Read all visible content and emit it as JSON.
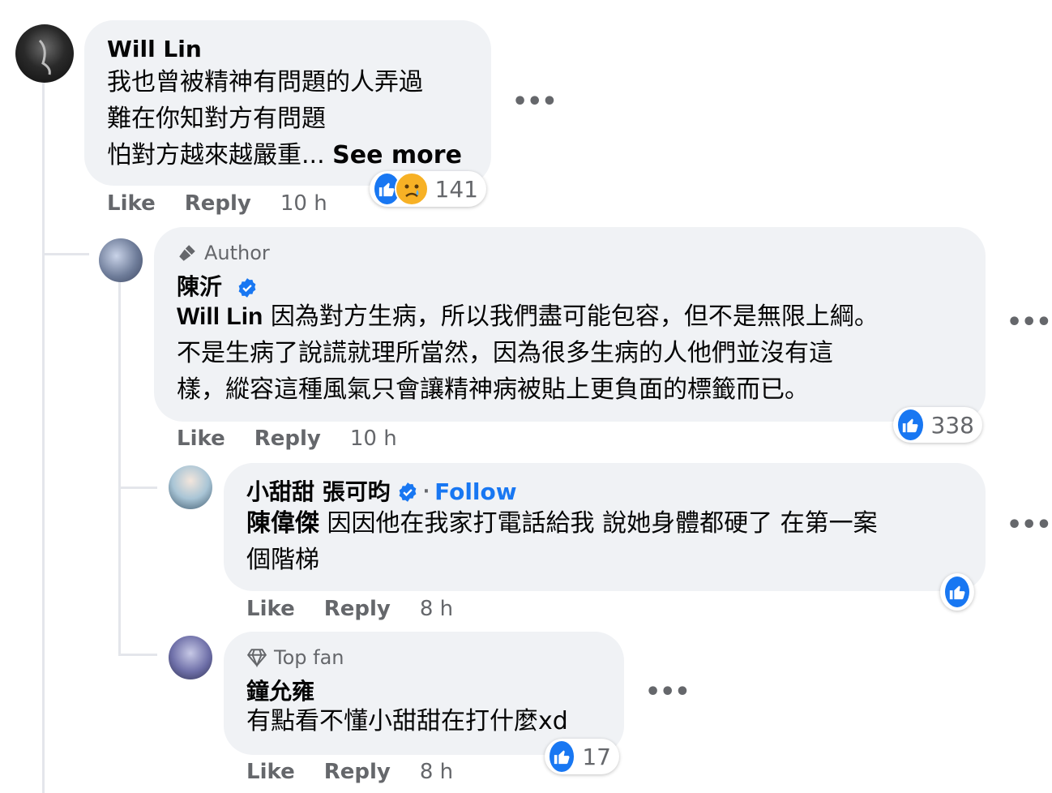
{
  "comments": [
    {
      "author": "Will Lin",
      "lines": [
        "我也曾被精神有問題的人弄過",
        "難在你知對方有問題",
        "怕對方越來越嚴重... "
      ],
      "see_more": "See more",
      "reaction_count": "141",
      "reactions": [
        "like",
        "sad"
      ],
      "like_label": "Like",
      "reply_label": "Reply",
      "time": "10 h"
    },
    {
      "badge": "Author",
      "author": "陳沂",
      "verified": true,
      "mention": "Will Lin",
      "lines": [
        " 因為對方生病，所以我們盡可能包容，但不是無限上綱。",
        "不是生病了說謊就理所當然，因為很多生病的人他們並沒有這",
        "樣，縱容這種風氣只會讓精神病被貼上更負面的標籤而已。"
      ],
      "reaction_count": "338",
      "reactions": [
        "like"
      ],
      "like_label": "Like",
      "reply_label": "Reply",
      "time": "10 h"
    },
    {
      "author": "小甜甜 張可昀",
      "verified": true,
      "separator": "·",
      "follow_label": "Follow",
      "mention": "陳偉傑",
      "lines": [
        " 因因他在我家打電話給我 說她身體都硬了 在第一案",
        "個階梯"
      ],
      "reactions": [
        "like"
      ],
      "like_label": "Like",
      "reply_label": "Reply",
      "time": "8 h"
    },
    {
      "badge": "Top fan",
      "author": "鐘允雍",
      "lines": [
        "有點看不懂小甜甜在打什麼xd"
      ],
      "reaction_count": "17",
      "reactions": [
        "like"
      ],
      "like_label": "Like",
      "reply_label": "Reply",
      "time": "8 h"
    }
  ],
  "more_icon": "•••",
  "colors": {
    "bubble": "#f0f2f5",
    "like_blue": "#1877f2",
    "meta_gray": "#65676b",
    "thread_line": "#e4e6eb"
  }
}
